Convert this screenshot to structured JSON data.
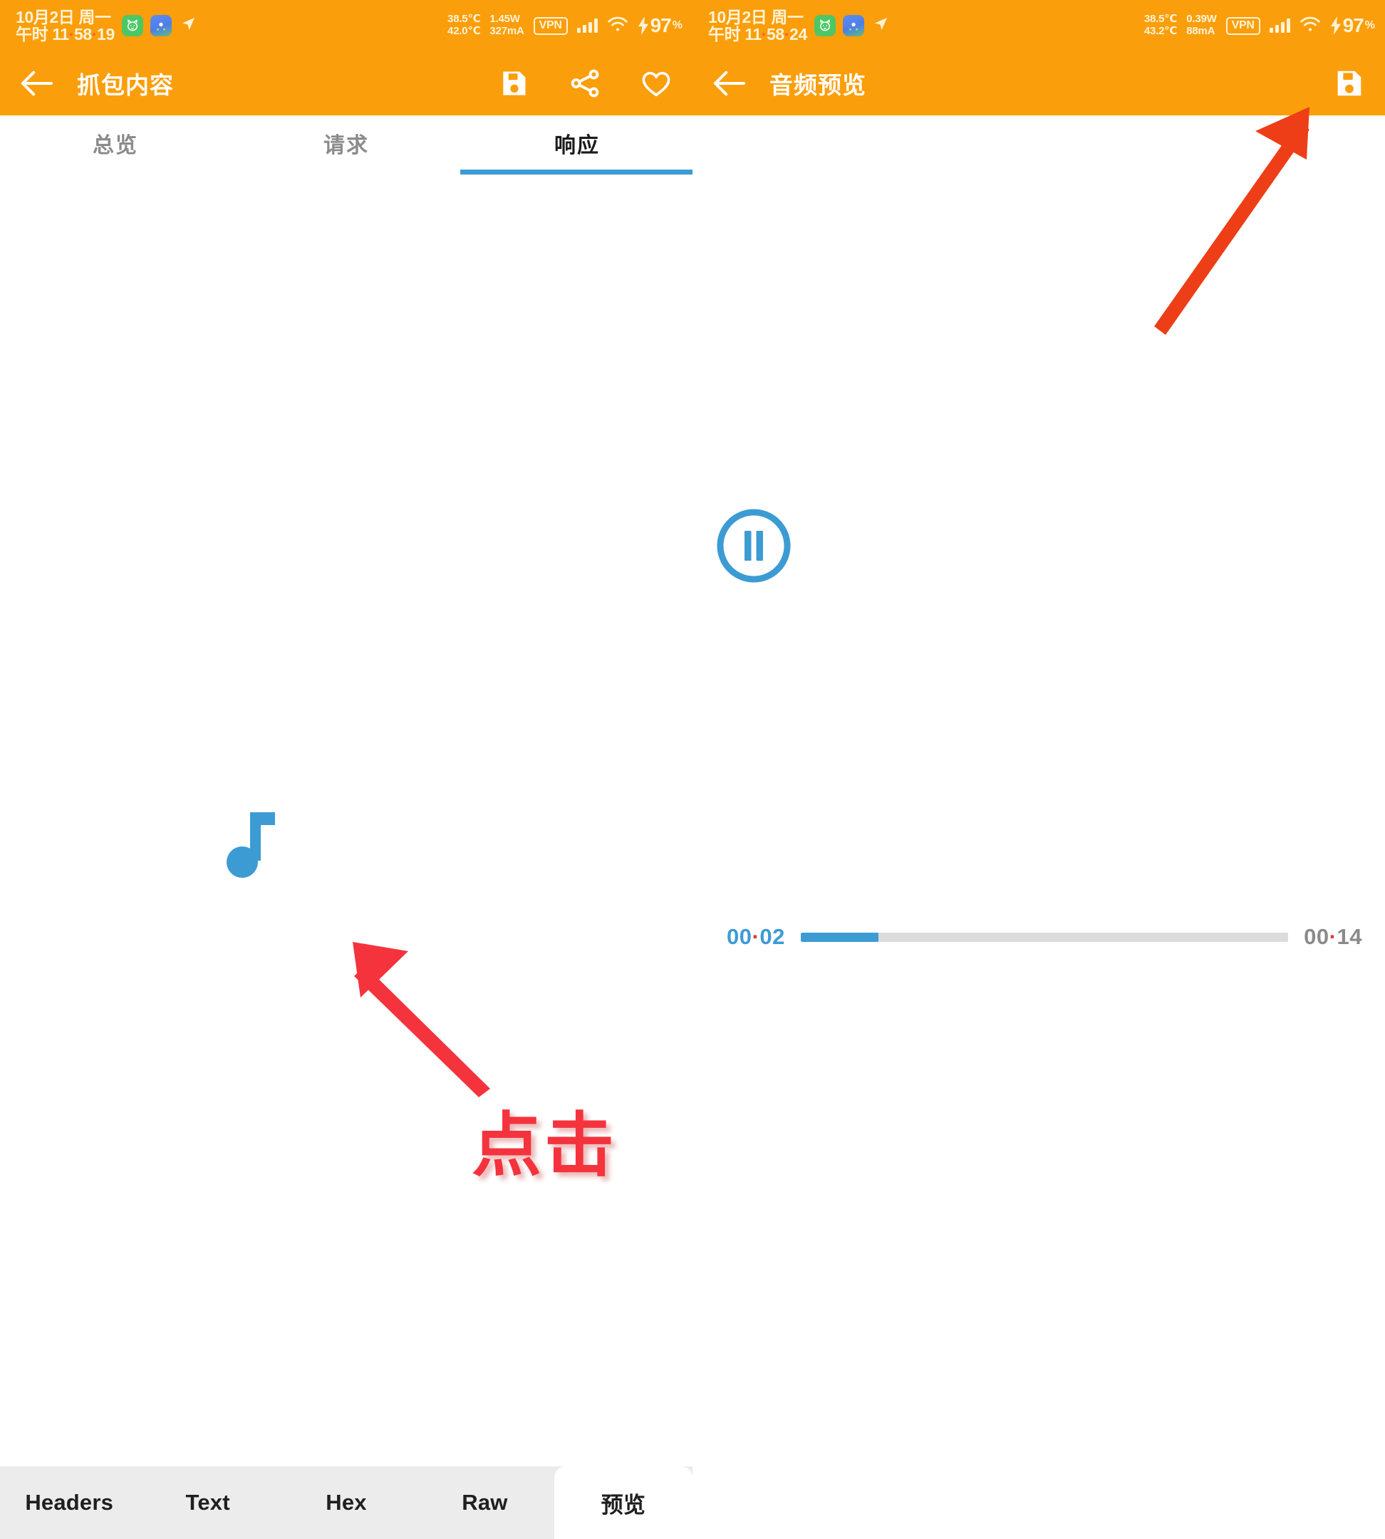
{
  "left_panel": {
    "statusbar": {
      "date": "10月2日 周一",
      "time_prefix": "午时",
      "time_h": "11",
      "time_m": "58",
      "time_s": "19",
      "sep": "·",
      "app_icon_1": "cat-face-icon",
      "app_icon_2": "map-app-icon",
      "nav_icon": "navigation-arrow-icon",
      "temp_line1": "38.5℃",
      "temp_line2": "42.0℃",
      "power_line1": "1.45W",
      "power_line2": "327mA",
      "vpn": "VPN",
      "signal_icon": "signal-bars-icon",
      "wifi_icon": "wifi-icon",
      "charging_icon": "lightning-bolt-icon",
      "battery": "97",
      "battery_unit": "%"
    },
    "appbar": {
      "back_icon": "back-arrow-icon",
      "title": "抓包内容",
      "save_icon": "save-icon",
      "share_icon": "share-icon",
      "favorite_icon": "heart-icon"
    },
    "tabs": [
      {
        "label": "总览",
        "active": false
      },
      {
        "label": "请求",
        "active": false
      },
      {
        "label": "响应",
        "active": true
      }
    ],
    "content": {
      "music_note_icon": "music-note-icon"
    },
    "bottom_tabs": [
      {
        "label": "Headers",
        "active": false
      },
      {
        "label": "Text",
        "active": false
      },
      {
        "label": "Hex",
        "active": false
      },
      {
        "label": "Raw",
        "active": false
      },
      {
        "label": "预览",
        "active": true
      }
    ]
  },
  "right_panel": {
    "statusbar": {
      "date": "10月2日 周一",
      "time_prefix": "午时",
      "time_h": "11",
      "time_m": "58",
      "time_s": "24",
      "sep": "·",
      "app_icon_1": "cat-face-icon",
      "app_icon_2": "map-app-icon",
      "nav_icon": "navigation-arrow-icon",
      "temp_line1": "38.5℃",
      "temp_line2": "43.2℃",
      "power_line1": "0.39W",
      "power_line2": "88mA",
      "vpn": "VPN",
      "signal_icon": "signal-bars-icon",
      "wifi_icon": "wifi-icon",
      "charging_icon": "lightning-bolt-icon",
      "battery": "97",
      "battery_unit": "%"
    },
    "appbar": {
      "back_icon": "back-arrow-icon",
      "title": "音频预览",
      "save_icon": "save-icon"
    },
    "player": {
      "state_icon": "pause-icon",
      "current_time": "00·02",
      "total_time": "00·14",
      "progress_percent": 16
    }
  },
  "annotations": {
    "click_label": "点击",
    "arrow_left_icon": "red-arrow-up-left-icon",
    "arrow_right_icon": "red-arrow-up-right-icon"
  },
  "colors": {
    "brand_orange": "#FB9E0B",
    "accent_blue": "#3D9BD4",
    "annotation_red": "#F4333D",
    "bottombar_grey": "#ECECEC"
  }
}
